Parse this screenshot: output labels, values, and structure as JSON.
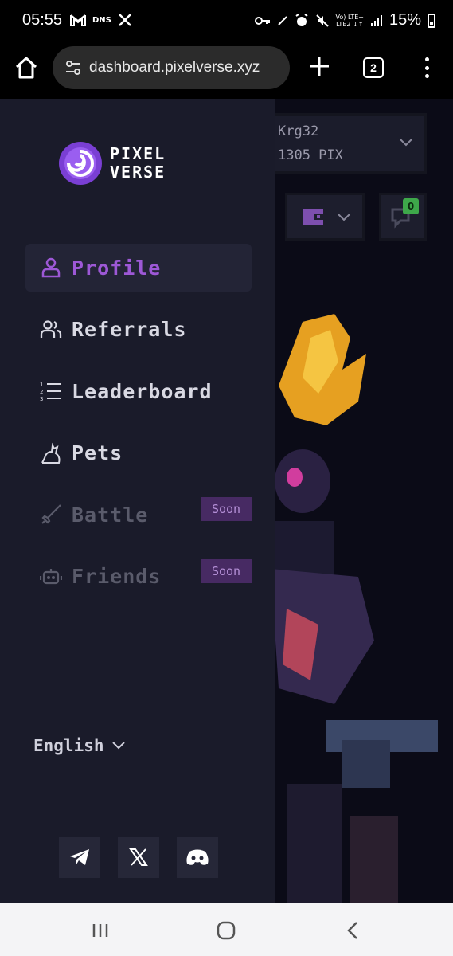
{
  "status_bar": {
    "time": "05:55",
    "left_icons": [
      "gmail-icon",
      "dns-icon",
      "tools-icon"
    ],
    "dns_label": "DNS",
    "right_icons": [
      "key-icon",
      "pen-icon",
      "alarm-icon",
      "mute-icon",
      "lte-icon",
      "signal-icon"
    ],
    "lte_label_top": "Vo) LTE+",
    "lte_label_bottom": "LTE2 ↓↑",
    "battery": "15%"
  },
  "browser": {
    "url": "dashboard.pixelverse.xyz",
    "tab_count": "2"
  },
  "account": {
    "username": "Krg32",
    "balance": "1305 PIX",
    "notification_count": "0"
  },
  "drawer": {
    "logo_line1": "PIXEL",
    "logo_line2": "VERSE",
    "nav": [
      {
        "label": "Profile",
        "icon": "user-icon",
        "state": "active"
      },
      {
        "label": "Referrals",
        "icon": "users-icon",
        "state": "normal"
      },
      {
        "label": "Leaderboard",
        "icon": "list-ordered-icon",
        "state": "normal"
      },
      {
        "label": "Pets",
        "icon": "cat-icon",
        "state": "normal"
      },
      {
        "label": "Battle",
        "icon": "sword-icon",
        "state": "disabled",
        "badge": "Soon"
      },
      {
        "label": "Friends",
        "icon": "robot-icon",
        "state": "disabled",
        "badge": "Soon"
      }
    ],
    "language": "English",
    "socials": [
      "telegram-icon",
      "x-icon",
      "discord-icon"
    ]
  },
  "colors": {
    "accent": "#9d58d6",
    "drawer_bg": "#1a1b2a",
    "page_bg": "#0b0b17",
    "badge_bg": "#472a63"
  }
}
